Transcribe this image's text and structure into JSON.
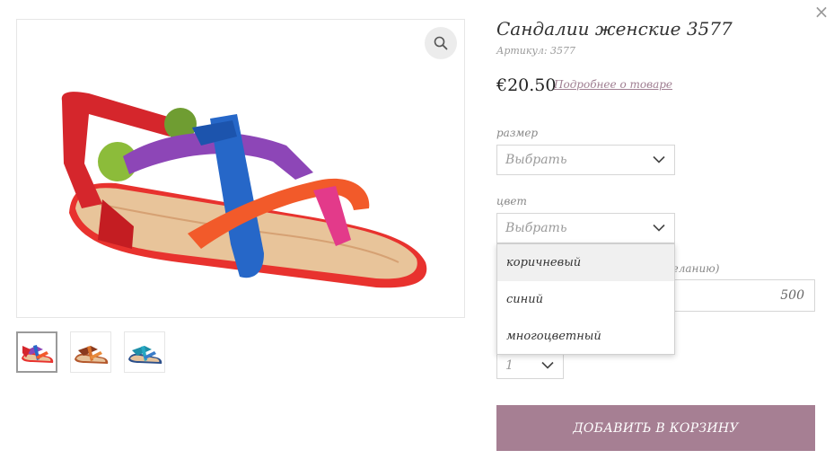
{
  "product": {
    "title": "Сандалии женские 3577",
    "sku": "Артикул: 3577",
    "price": "€20.50",
    "details_link": "Подробнее о товаре"
  },
  "size": {
    "label": "размер",
    "value": "Выбрать"
  },
  "color": {
    "label": "цвет",
    "value": "Выбрать",
    "options": [
      "коричневый",
      "синий",
      "многоцветный"
    ]
  },
  "extra_field": {
    "label_fragment": "желанию)",
    "value": "500"
  },
  "quantity": {
    "value": "1"
  },
  "add_to_cart_label": "ДОБАВИТЬ В КОРЗИНУ",
  "icons": {
    "close": "close-icon",
    "zoom": "magnifier-icon",
    "chevron": "chevron-down-icon"
  },
  "colors": {
    "accent": "#a67f93",
    "link": "#a07f92"
  }
}
